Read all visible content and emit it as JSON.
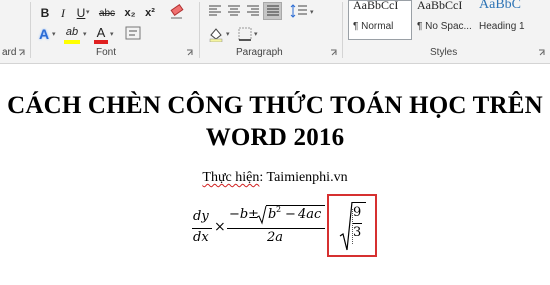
{
  "ribbon": {
    "font_group_label": "Font",
    "paragraph_group_label": "Paragraph",
    "styles_group_label": "Styles",
    "clipboard_group_label": "ard",
    "format_buttons": {
      "bold": "B",
      "italic": "I",
      "underline": "U",
      "strikethrough": "abc",
      "subscript": "x₂",
      "superscript": "x²"
    },
    "font_color_letter": "A",
    "text_effects_letter": "A",
    "highlight_letters": "ab",
    "styles": [
      {
        "sample": "AaBbCcI",
        "name": "¶ Normal"
      },
      {
        "sample": "AaBbCcI",
        "name": "¶ No Spac..."
      },
      {
        "sample": "AaBbC",
        "name": "Heading 1"
      }
    ],
    "colors": {
      "highlight": "#ffff00",
      "font_color": "#e02020",
      "heading_sample": "#2e74b5"
    }
  },
  "document": {
    "title_line1": "CÁCH CHÈN CÔNG THỨC TOÁN HỌC TRÊN",
    "title_line2": "WORD 2016",
    "byline_label": "Thực hiện",
    "byline_sep": ": ",
    "byline_site": "Taimienphi.vn",
    "formula": {
      "dy": "dy",
      "dx": "dx",
      "times": "×",
      "minus_b": "−b",
      "pm": "±",
      "b2": "b",
      "b2_exp": "2",
      "minus": "−",
      "four_ac": "4ac",
      "two_a": "2a",
      "nine": "9",
      "three": "3"
    }
  }
}
